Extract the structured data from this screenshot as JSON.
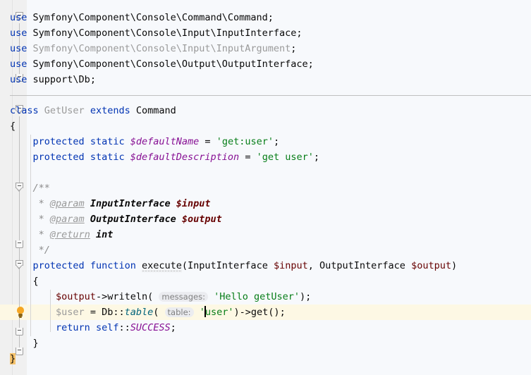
{
  "editor": {
    "language": "php",
    "theme": "IntelliJ Light",
    "line_height_px": 22,
    "colors": {
      "background": "#F7F9FC",
      "gutter": "#F0F0F0",
      "keyword": "#0033B3",
      "string": "#067D17",
      "field": "#871094",
      "constant": "#871094",
      "variable": "#660000",
      "comment": "#8C8C8C",
      "grayed_out": "#9A9A9A",
      "static_method": "#00627A",
      "inlay_hint_bg": "#EBECF0",
      "inlay_hint_text": "#808080",
      "current_line": "#FDF8E4",
      "brace_match": "#F5C26B",
      "separator": "#C0C0C0",
      "caret": "#000000",
      "bulb": "#F5A623"
    }
  },
  "code": {
    "imports": [
      {
        "keyword": "use",
        "path": "Symfony\\Component\\Console\\Command\\Command",
        "terminator": ";",
        "unused": false
      },
      {
        "keyword": "use",
        "path": "Symfony\\Component\\Console\\Input\\InputInterface",
        "terminator": ";",
        "unused": false
      },
      {
        "keyword": "use",
        "path": "Symfony\\Component\\Console\\Input\\InputArgument",
        "terminator": ";",
        "unused": true
      },
      {
        "keyword": "use",
        "path": "Symfony\\Component\\Console\\Output\\OutputInterface",
        "terminator": ";",
        "unused": false
      },
      {
        "keyword": "use",
        "path": "support\\Db",
        "terminator": ";",
        "unused": false
      }
    ],
    "class_declaration": {
      "keyword_class": "class",
      "name": "GetUser",
      "keyword_extends": "extends",
      "parent": "Command"
    },
    "brace_open_class": "{",
    "brace_close_class": "}",
    "properties": [
      {
        "modifier": "protected",
        "static": "static",
        "name": "$defaultName",
        "operator": "=",
        "value": "'get:user'",
        "terminator": ";"
      },
      {
        "modifier": "protected",
        "static": "static",
        "name": "$defaultDescription",
        "operator": "=",
        "value": "'get user'",
        "terminator": ";"
      }
    ],
    "docblock": {
      "open": "/**",
      "lines": [
        {
          "star": "*",
          "tag": "@param",
          "type": "InputInterface",
          "variable": "$input"
        },
        {
          "star": "*",
          "tag": "@param",
          "type": "OutputInterface",
          "variable": "$output"
        },
        {
          "star": "*",
          "tag": "@return",
          "type": "int",
          "variable": ""
        }
      ],
      "close": "*/"
    },
    "method": {
      "modifier": "protected",
      "keyword_function": "function",
      "name": "execute",
      "has_weak_warning": true,
      "paren_open": "(",
      "params": [
        {
          "type": "InputInterface",
          "variable": "$input"
        },
        {
          "type": "OutputInterface",
          "variable": "$output"
        }
      ],
      "param_separator": ", ",
      "paren_close": ")",
      "brace_open": "{",
      "brace_close": "}",
      "body": [
        {
          "id": "writeln-call",
          "receiver": "$output",
          "arrow": "->",
          "call": "writeln",
          "paren_open": "(",
          "hint": "messages:",
          "argument": "'Hello getUser'",
          "paren_close": ")",
          "terminator": ";"
        },
        {
          "id": "db-table-call",
          "assignee": "$user",
          "assignee_unused": true,
          "operator": "=",
          "class": "Db",
          "scope_resolution": "::",
          "call": "table",
          "paren_open": "(",
          "hint": "table:",
          "argument_quote_open": "'",
          "argument_value": "user",
          "argument_quote_close": "'",
          "paren_close": ")",
          "chain_arrow": "->",
          "chain_call": "get",
          "chain_parens": "()",
          "terminator": ";",
          "is_current_line": true,
          "has_caret": true,
          "has_intention_bulb": true
        },
        {
          "id": "return-stmt",
          "keyword": "return",
          "scope": "self",
          "scope_resolution": "::",
          "constant": "SUCCESS",
          "terminator": ";"
        }
      ]
    }
  }
}
